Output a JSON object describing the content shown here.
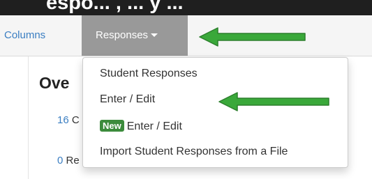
{
  "header": {
    "partial_title": "espo... , ... y ..."
  },
  "nav": {
    "tabs": [
      {
        "label": "Columns"
      },
      {
        "label": "Responses"
      }
    ]
  },
  "main": {
    "heading": "Ove",
    "stats": [
      {
        "count": "16",
        "label_fragment": "C"
      },
      {
        "count": "0",
        "label_fragment": "Re"
      }
    ]
  },
  "dropdown": {
    "items": [
      {
        "label": "Student Responses"
      },
      {
        "label": "Enter / Edit"
      },
      {
        "badge": "New",
        "label": "Enter / Edit"
      },
      {
        "label": "Import Student Responses from a File"
      }
    ]
  },
  "colors": {
    "link": "#3a7ec2",
    "active_tab": "#999999",
    "badge": "#3c8b3c",
    "annotation_arrow": "#3aa83a"
  },
  "icons": {
    "tab_caret": "caret-down-icon",
    "annotation": "arrow-left-icon"
  }
}
